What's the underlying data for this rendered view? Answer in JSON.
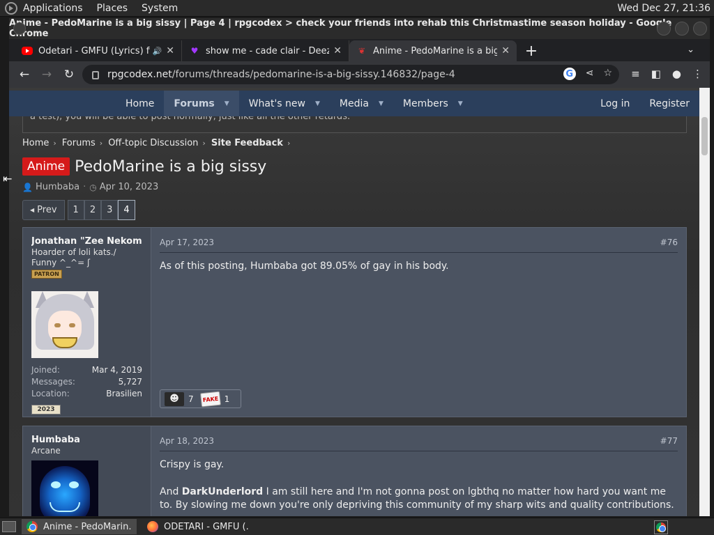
{
  "desktop": {
    "menus": [
      "Applications",
      "Places",
      "System"
    ],
    "clock": "Wed Dec 27, 21:36"
  },
  "window": {
    "title": "Anime - PedoMarine is a big sissy | Page 4 | rpgcodex > check your friends into rehab this Christmastime season holiday - Google Chrome"
  },
  "tabs": [
    {
      "label": "Odetari - GMFU (Lyrics) ft",
      "icon": "youtube-icon",
      "audio": "🔊"
    },
    {
      "label": "show me - cade clair - Deezer",
      "icon": "deezer-heart-icon"
    },
    {
      "label": "Anime - PedoMarine is a big sissy",
      "icon": "rpgcodex-icon",
      "active": true
    }
  ],
  "toolbar": {
    "url_host": "rpgcodex.net",
    "url_path": "/forums/threads/pedomarine-is-a-big-sissy.146832/page-4"
  },
  "nav": {
    "items": [
      "Home",
      "Forums",
      "What's new",
      "Media",
      "Members"
    ],
    "login": "Log in",
    "register": "Register"
  },
  "notice": "a test), you will be able to post normally, just like all the other retards.",
  "breadcrumb": [
    "Home",
    "Forums",
    "Off-topic Discussion",
    "Site Feedback"
  ],
  "thread": {
    "prefix": "Anime",
    "title": "PedoMarine is a big sissy",
    "author": "Humbaba",
    "date": "Apr 10, 2023"
  },
  "pagination": {
    "prev": "Prev",
    "pages": [
      "1",
      "2",
      "3",
      "4"
    ],
    "current": "4"
  },
  "posts": [
    {
      "username": "Jonathan \"Zee Nekomimi",
      "usertitle": "Hoarder of loli kats./ Funny ^_^= ʃ",
      "badge": "PATRON",
      "joined_label": "Joined:",
      "joined": "Mar 4, 2019",
      "messages_label": "Messages:",
      "messages": "5,727",
      "location_label": "Location:",
      "location": "Brasilien",
      "trophy": "2023",
      "date": "Apr 17, 2023",
      "number": "#76",
      "body": [
        "As of this posting, Humbaba got 89.05% of gay in his body."
      ],
      "reactions": [
        {
          "icon": "moe-reaction-icon",
          "count": "7"
        },
        {
          "icon": "fake-news-reaction-icon",
          "label": "FAKE",
          "count": "1"
        }
      ]
    },
    {
      "username": "Humbaba",
      "usertitle": "Arcane",
      "date": "Apr 18, 2023",
      "number": "#77",
      "body1": "Crispy is gay.",
      "body2_pre": "And ",
      "body2_name": "DarkUnderlord",
      "body2_post": " I am still here and I'm not gonna post on lgbthq no matter how hard you want me to. By slowing me down you're only depriving this community of my sharp wits and quality contributions."
    }
  ],
  "taskbar": [
    {
      "label": "Anime - PedoMarin...",
      "icon": "chrome-icon",
      "active": true
    },
    {
      "label": "ODETARI - GMFU (...",
      "icon": "firefox-icon"
    }
  ]
}
